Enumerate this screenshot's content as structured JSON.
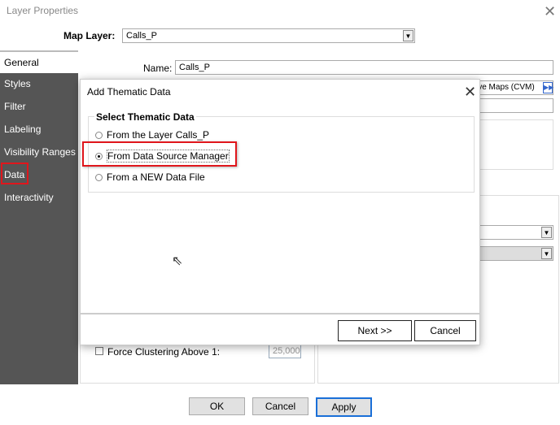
{
  "window": {
    "title": "Layer Properties",
    "close_icon": "close-icon"
  },
  "map_layer": {
    "label": "Map Layer:",
    "value": "Calls_P"
  },
  "sidebar": {
    "items": [
      {
        "label": "General",
        "selected": true
      },
      {
        "label": "Styles"
      },
      {
        "label": "Filter"
      },
      {
        "label": "Labeling"
      },
      {
        "label": "Visibility Ranges"
      },
      {
        "label": "Data",
        "highlighted": true
      },
      {
        "label": "Interactivity"
      }
    ]
  },
  "general": {
    "name_label": "Name:",
    "name_value": "Calls_P",
    "cvm_button": "ive Maps (CVM)",
    "force_clustering_label": "Force Clustering Above 1:",
    "force_clustering_value": "25,000"
  },
  "dialog": {
    "title": "Add Thematic Data",
    "group_title": "Select Thematic Data",
    "options": [
      {
        "label": "From the Layer Calls_P",
        "checked": false
      },
      {
        "label": "From Data Source Manager",
        "checked": true
      },
      {
        "label": "From a NEW Data File",
        "checked": false
      }
    ],
    "next_label": "Next >>",
    "cancel_label": "Cancel"
  },
  "footer": {
    "ok": "OK",
    "cancel": "Cancel",
    "apply": "Apply"
  },
  "colors": {
    "highlight": "#e0161c",
    "sidebar": "#555555",
    "apply_border": "#1a6fd8"
  }
}
